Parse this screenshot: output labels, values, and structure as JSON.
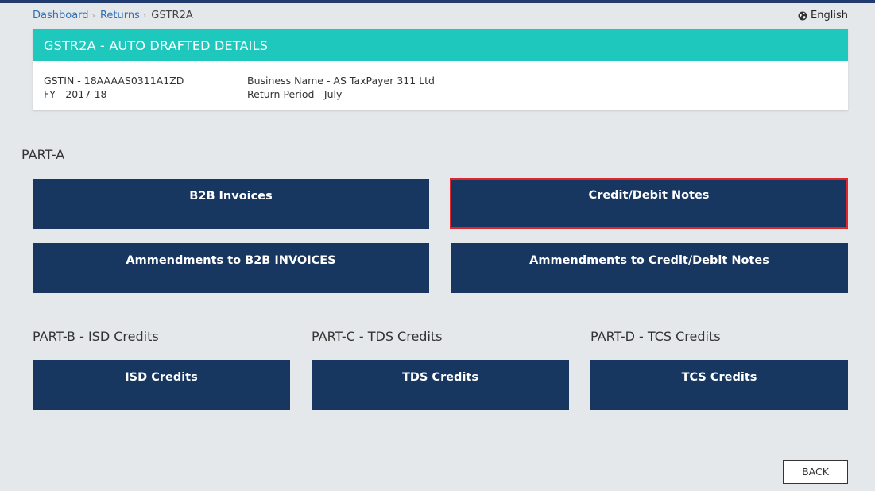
{
  "breadcrumb": {
    "items": [
      "Dashboard",
      "Returns"
    ],
    "current": "GSTR2A"
  },
  "language": {
    "label": "English",
    "icon": "globe-icon"
  },
  "details": {
    "title": "GSTR2A - AUTO DRAFTED DETAILS",
    "gstin": "GSTIN - 18AAAAS0311A1ZD",
    "fy": "FY - 2017-18",
    "business_name": "Business Name - AS TaxPayer 311 Ltd",
    "return_period": "Return Period - July"
  },
  "part_a": {
    "label": "PART-A",
    "tiles": [
      "B2B Invoices",
      "Credit/Debit Notes",
      "Ammendments to B2B INVOICES",
      "Ammendments to Credit/Debit Notes"
    ],
    "selected": "Credit/Debit Notes"
  },
  "part_b": {
    "label": "PART-B - ISD Credits",
    "tile": "ISD Credits"
  },
  "part_c": {
    "label": "PART-C - TDS Credits",
    "tile": "TDS Credits"
  },
  "part_d": {
    "label": "PART-D - TCS Credits",
    "tile": "TCS Credits"
  },
  "actions": {
    "back_label": "BACK"
  },
  "colors": {
    "header_teal": "#1fc8bc",
    "tile_navy": "#173660",
    "selection_red": "#e0262d",
    "link_blue": "#2f70b4"
  }
}
